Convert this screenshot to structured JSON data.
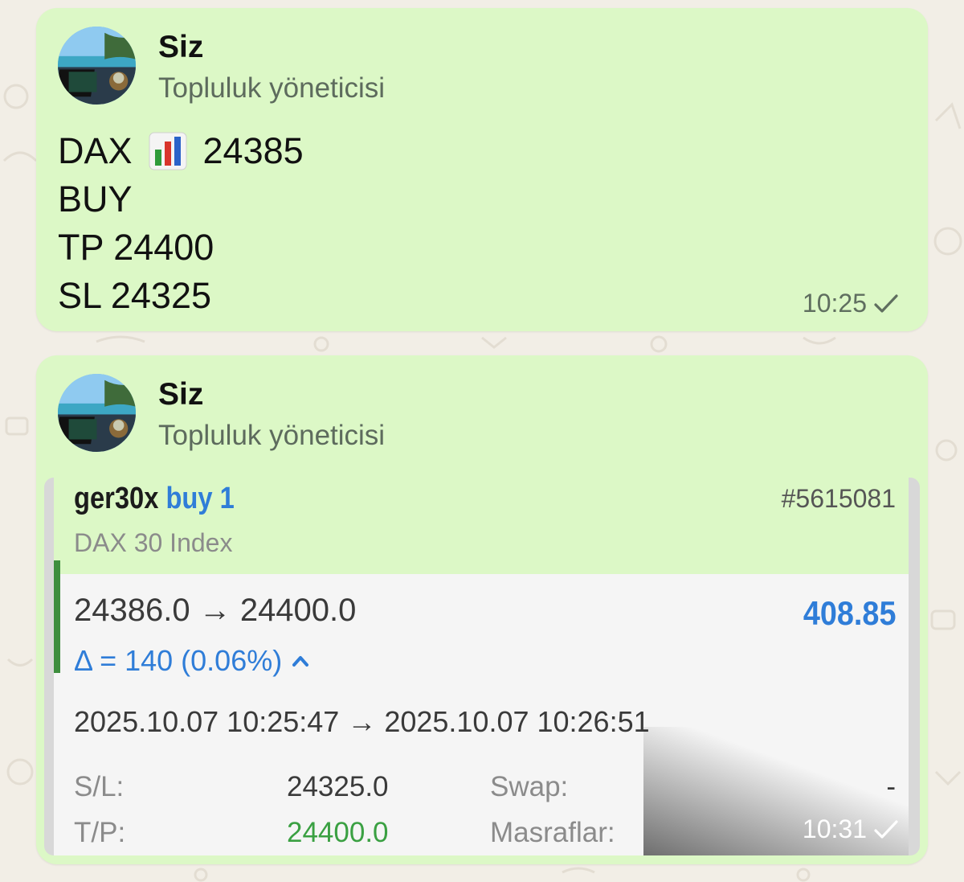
{
  "messages": [
    {
      "sender": "Siz",
      "role": "Topluluk yöneticisi",
      "lines": [
        "DAX",
        "24385",
        "BUY",
        "TP 24400",
        "SL 24325"
      ],
      "emoji": "bar-chart-emoji",
      "time": "10:25",
      "status": "sent"
    },
    {
      "sender": "Siz",
      "role": "Topluluk yöneticisi",
      "time": "10:31",
      "status": "sent",
      "trade_card": {
        "symbol": "ger30x",
        "direction": "buy 1",
        "order_id": "#5615081",
        "instrument": "DAX 30 Index",
        "price_range": "24386.0 → 24400.0",
        "profit": "408.85",
        "delta": "Δ = 140 (0.06%)",
        "times": "2025.10.07 10:25:47 → 2025.10.07 10:26:51",
        "sl_label": "S/L:",
        "sl_value": "24325.0",
        "tp_label": "T/P:",
        "tp_value": "24400.0",
        "swap_label": "Swap:",
        "swap_value": "-",
        "fees_label": "Masraflar:"
      }
    }
  ],
  "colors": {
    "bubble": "#dcf8c6",
    "wallpaper": "#f2eee6",
    "accent_blue": "#2f7dd8",
    "tp_green": "#3aa042",
    "bar_green": "#3e8e3e"
  }
}
